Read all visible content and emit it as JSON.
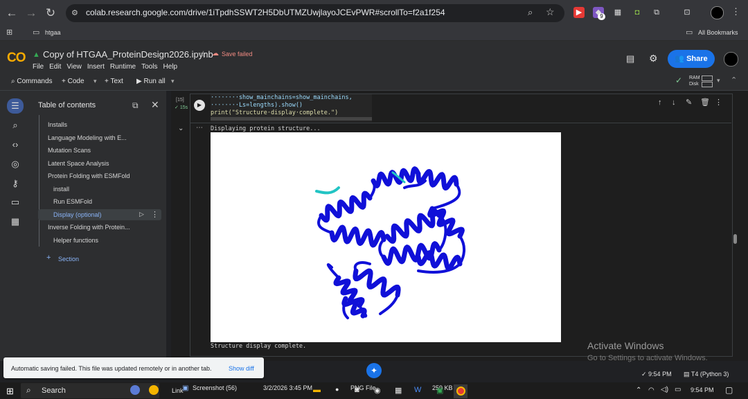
{
  "browser": {
    "url": "colab.research.google.com/drive/1iTpdhSSWT2H5DbUTMZUwjlayoJCEvPWR#scrollTo=f2a1f254",
    "ext_badge": "9",
    "bookmark_folder": "htgaa",
    "all_bookmarks": "All Bookmarks"
  },
  "colab": {
    "logo": "CO",
    "title": "Copy of HTGAA_ProteinDesign2026.ipynb",
    "save_status": "Save failed",
    "menu": [
      "File",
      "Edit",
      "View",
      "Insert",
      "Runtime",
      "Tools",
      "Help"
    ],
    "share": "Share",
    "toolbar": {
      "commands": "Commands",
      "code": "+ Code",
      "text": "+ Text",
      "run_all": "Run all"
    },
    "ram_label": "RAM",
    "disk_label": "Disk"
  },
  "toc": {
    "title": "Table of contents",
    "items": [
      {
        "label": "Installs"
      },
      {
        "label": "Language Modeling with E..."
      },
      {
        "label": "Mutation Scans"
      },
      {
        "label": "Latent Space Analysis"
      },
      {
        "label": "Protein Folding with ESMFold"
      },
      {
        "label": "install"
      },
      {
        "label": "Run ESMFold"
      },
      {
        "label": "Display (optional)"
      },
      {
        "label": "Inverse Folding with Protein..."
      },
      {
        "label": "Helper functions"
      }
    ],
    "add_section": "Section"
  },
  "cell": {
    "exec_count": "[15]",
    "exec_time": "15s",
    "code_lines": [
      "········show_mainchains=show_mainchains,",
      "········Ls=lengths).show()",
      "print(\"Structure·display·complete.\")"
    ],
    "output_first": "Displaying protein structure...",
    "output_last": "Structure display complete."
  },
  "watermark": {
    "line1": "Activate Windows",
    "line2": "Go to Settings to activate Windows."
  },
  "toast": {
    "message": "Automatic saving failed. This file was updated remotely or in another tab.",
    "action": "Show diff"
  },
  "status": {
    "time": "9:54 PM",
    "runtime": "T4 (Python 3)"
  },
  "taskbar": {
    "search": "Search",
    "link": "Link",
    "screenshot": "Screenshot (56)",
    "file_date": "3/2/2026 3:45 PM",
    "png": "PNG File",
    "size": "259 KB",
    "time": "9:54 PM"
  },
  "colors": {
    "accent": "#1a73e8",
    "protein": "#1010d8",
    "protein_tail": "#22c4c4",
    "save_failed": "#f28b82"
  }
}
